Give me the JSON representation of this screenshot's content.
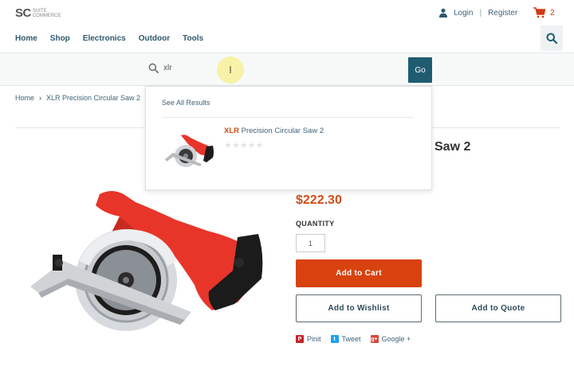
{
  "logo": {
    "mark": "SC",
    "sub_line1": "SUITE",
    "sub_line2": "COMMERCE"
  },
  "account": {
    "login": "Login",
    "separator": "|",
    "register": "Register"
  },
  "cart": {
    "count": "2"
  },
  "nav": {
    "items": [
      "Home",
      "Shop",
      "Electronics",
      "Outdoor",
      "Tools"
    ]
  },
  "search": {
    "value": "xlr",
    "go_label": "Go",
    "cursor_glyph": "I"
  },
  "breadcrumb": {
    "home": "Home",
    "current": "XLR Precision Circular Saw 2"
  },
  "dropdown": {
    "see_all": "See All Results",
    "result_match": "XLR",
    "result_rest": " Precision Circular Saw 2",
    "stars": "★★★★★",
    "rating": 0
  },
  "product": {
    "title_visible": "Saw 2",
    "price": "$222.30",
    "quantity_label": "QUANTITY",
    "quantity_value": "1",
    "add_to_cart": "Add to Cart",
    "add_to_wishlist": "Add to Wishlist",
    "add_to_quote": "Add to Quote"
  },
  "share": {
    "pinit": "Pinit",
    "tweet": "Tweet",
    "google": "Google +"
  },
  "colors": {
    "accent": "#d8420f",
    "primary": "#1f5c70",
    "link": "#40637a"
  }
}
